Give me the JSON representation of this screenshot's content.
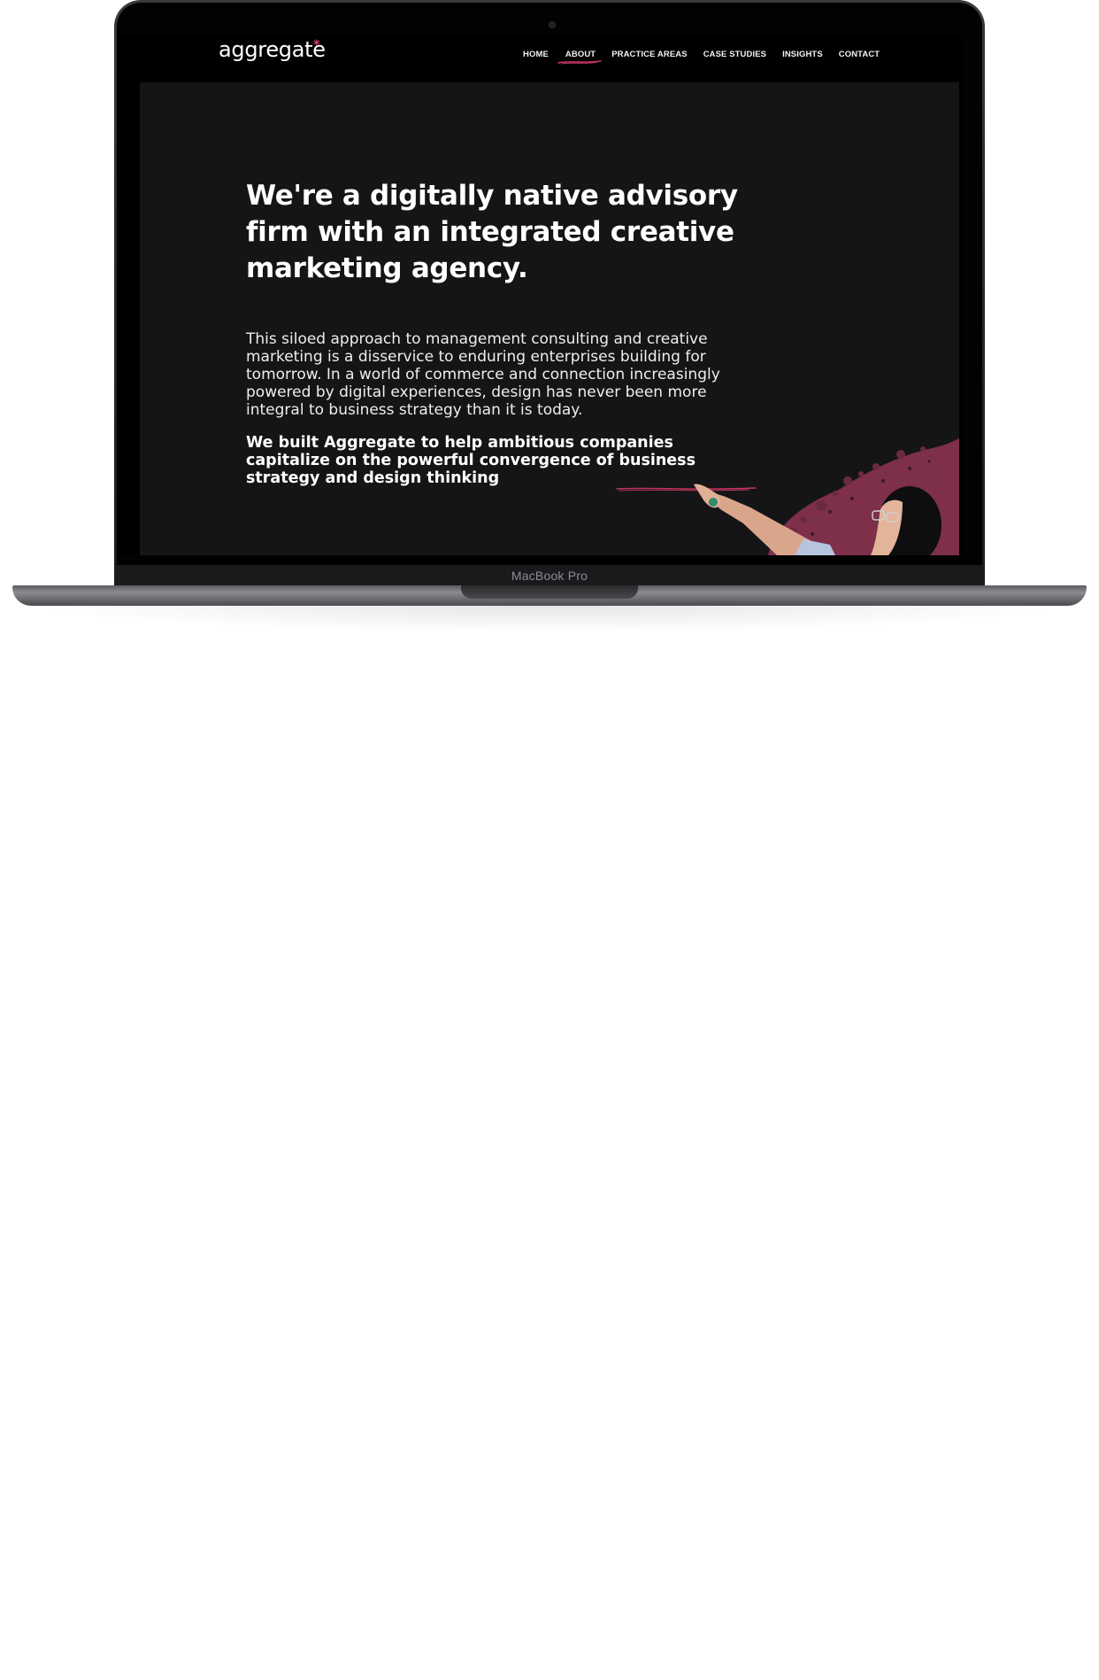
{
  "device": {
    "label": "MacBook Pro"
  },
  "site": {
    "logo_text": "aggregate",
    "logo_mark": "*",
    "brand_accent": "#c2355f"
  },
  "nav": {
    "items": [
      {
        "label": "HOME",
        "active": false
      },
      {
        "label": "ABOUT",
        "active": true
      },
      {
        "label": "PRACTICE AREAS",
        "active": false
      },
      {
        "label": "CASE STUDIES",
        "active": false
      },
      {
        "label": "INSIGHTS",
        "active": false
      },
      {
        "label": "CONTACT",
        "active": false
      }
    ]
  },
  "hero": {
    "headline": "We're a digitally native advisory firm with an integrated creative marketing agency.",
    "body": "This siloed approach to management consulting and creative marketing is a disservice to enduring enterprises building for tomorrow. In a world of commerce and connection increasingly powered by digital experiences, design has never been more integral to business strategy than it is today.",
    "strong_before": "We built Aggregate to help ambitious companies capitalize on the powerful convergence of ",
    "strong_highlight": "business strategy",
    "strong_after": " and design thinking",
    "image_icon": "woman-pointing-illustration"
  },
  "colors": {
    "page_bg": "#151517",
    "nav_bg": "#000000",
    "accent_paint": "#8a3450",
    "text": "#ffffff"
  }
}
